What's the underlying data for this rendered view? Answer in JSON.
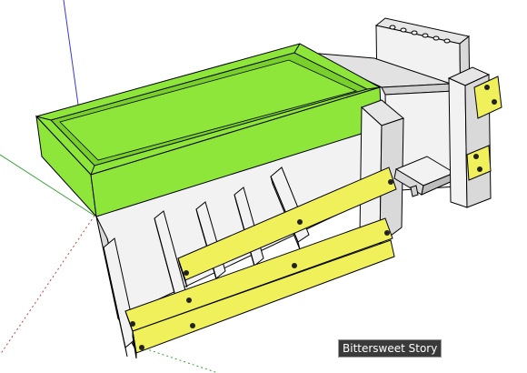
{
  "viewport": {
    "watermark_text": "Bittersweet Story"
  },
  "colors": {
    "background": "#ffffff",
    "tray_green": "#8fe63a",
    "tray_green_dark": "#6fc622",
    "box_white": "#f2f2f2",
    "box_shade": "#d9d9d9",
    "box_dark_shade": "#bdbdbd",
    "slat_yellow": "#f0f05a",
    "slat_yellow_dark": "#d2d23a",
    "axis_red": "#c84040",
    "axis_green": "#3aa33a",
    "axis_blue": "#3a3ad0"
  }
}
